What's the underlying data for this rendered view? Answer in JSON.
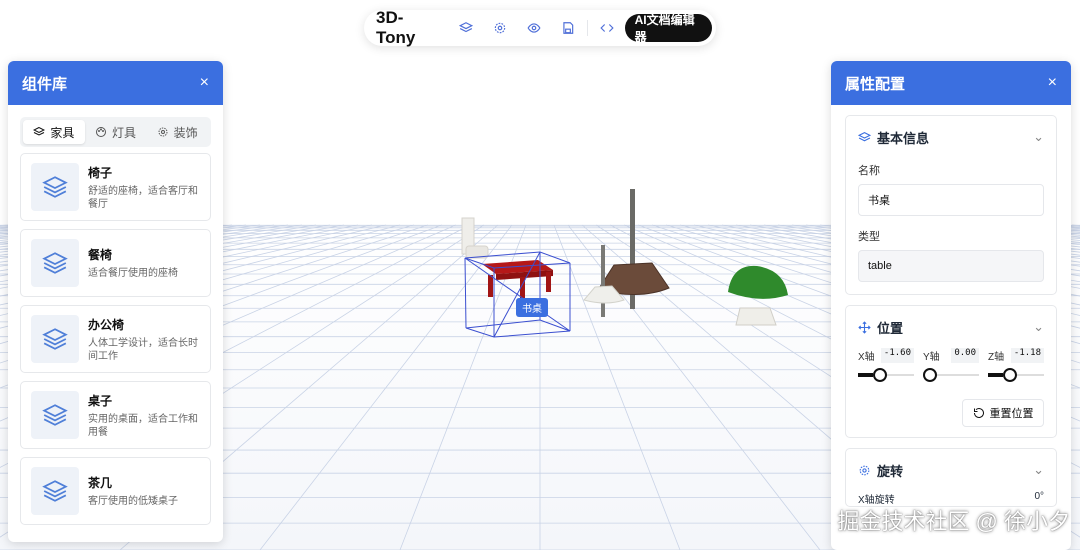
{
  "toolbar": {
    "brand": "3D-Tony",
    "icons": [
      "layers-icon",
      "settings-icon",
      "eye-icon",
      "save-icon",
      "code-icon"
    ],
    "ai_button": "AI文档编辑器"
  },
  "library": {
    "title": "组件库",
    "close": "×",
    "tabs": [
      {
        "label": "家具",
        "icon": "layers-icon",
        "active": true
      },
      {
        "label": "灯具",
        "icon": "palette-icon",
        "active": false
      },
      {
        "label": "装饰",
        "icon": "gear-icon",
        "active": false
      }
    ],
    "items": [
      {
        "name": "椅子",
        "desc": "舒适的座椅，适合客厅和餐厅"
      },
      {
        "name": "餐椅",
        "desc": "适合餐厅使用的座椅"
      },
      {
        "name": "办公椅",
        "desc": "人体工学设计，适合长时间工作"
      },
      {
        "name": "桌子",
        "desc": "实用的桌面，适合工作和用餐"
      },
      {
        "name": "茶几",
        "desc": "客厅使用的低矮桌子"
      }
    ]
  },
  "scene": {
    "selected_label": "书桌",
    "accent": "#3b6fe0"
  },
  "properties": {
    "title": "属性配置",
    "close": "×",
    "basic": {
      "title": "基本信息",
      "name_label": "名称",
      "name_value": "书桌",
      "type_label": "类型",
      "type_value": "table"
    },
    "position": {
      "title": "位置",
      "axes": [
        {
          "label": "X轴",
          "value": "-1.60",
          "level": 0.35
        },
        {
          "label": "Y轴",
          "value": "0.00",
          "level": 0.0
        },
        {
          "label": "Z轴",
          "value": "-1.18",
          "level": 0.35
        }
      ],
      "reset": "重置位置"
    },
    "rotation": {
      "title": "旋转",
      "x_label": "X轴旋转",
      "x_value": "0°"
    }
  },
  "watermark": "掘金技术社区 @ 徐小夕"
}
